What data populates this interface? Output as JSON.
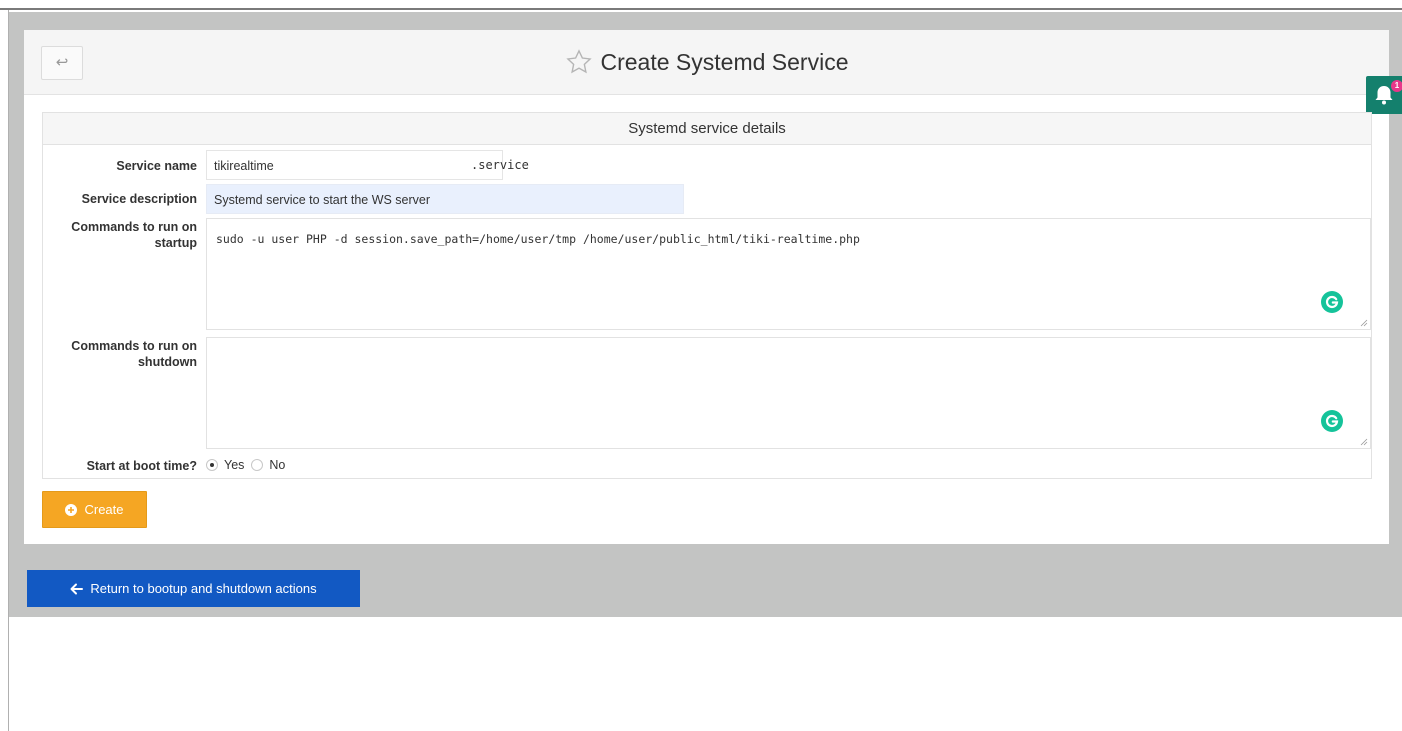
{
  "header": {
    "back_icon": "arrow-left-icon",
    "title": "Create Systemd Service",
    "title_icon": "star-outline-icon"
  },
  "notification": {
    "icon": "bell-icon",
    "badge": "1",
    "color": "#14806d"
  },
  "form": {
    "legend": "Systemd service details",
    "service_name": {
      "label": "Service name",
      "value": "tikirealtime",
      "suffix": ".service"
    },
    "service_description": {
      "label": "Service description",
      "value": "Systemd service to start the WS server"
    },
    "startup": {
      "label_line1": "Commands to run on",
      "label_line2": "startup",
      "value": "sudo -u user PHP -d session.save_path=/home/user/tmp /home/user/public_html/tiki-realtime.php"
    },
    "shutdown": {
      "label_line1": "Commands to run on",
      "label_line2": "shutdown",
      "value": ""
    },
    "boot": {
      "label": "Start at boot time?",
      "options": [
        {
          "label": "Yes",
          "selected": true
        },
        {
          "label": "No",
          "selected": false
        }
      ]
    }
  },
  "buttons": {
    "create": {
      "label": "Create",
      "icon": "plus-circle-icon",
      "color": "#f5a623"
    },
    "return": {
      "label": "Return to bootup and shutdown actions",
      "icon": "arrow-left-icon",
      "color": "#1259c3"
    }
  },
  "grammarly_icon": "grammarly-icon"
}
